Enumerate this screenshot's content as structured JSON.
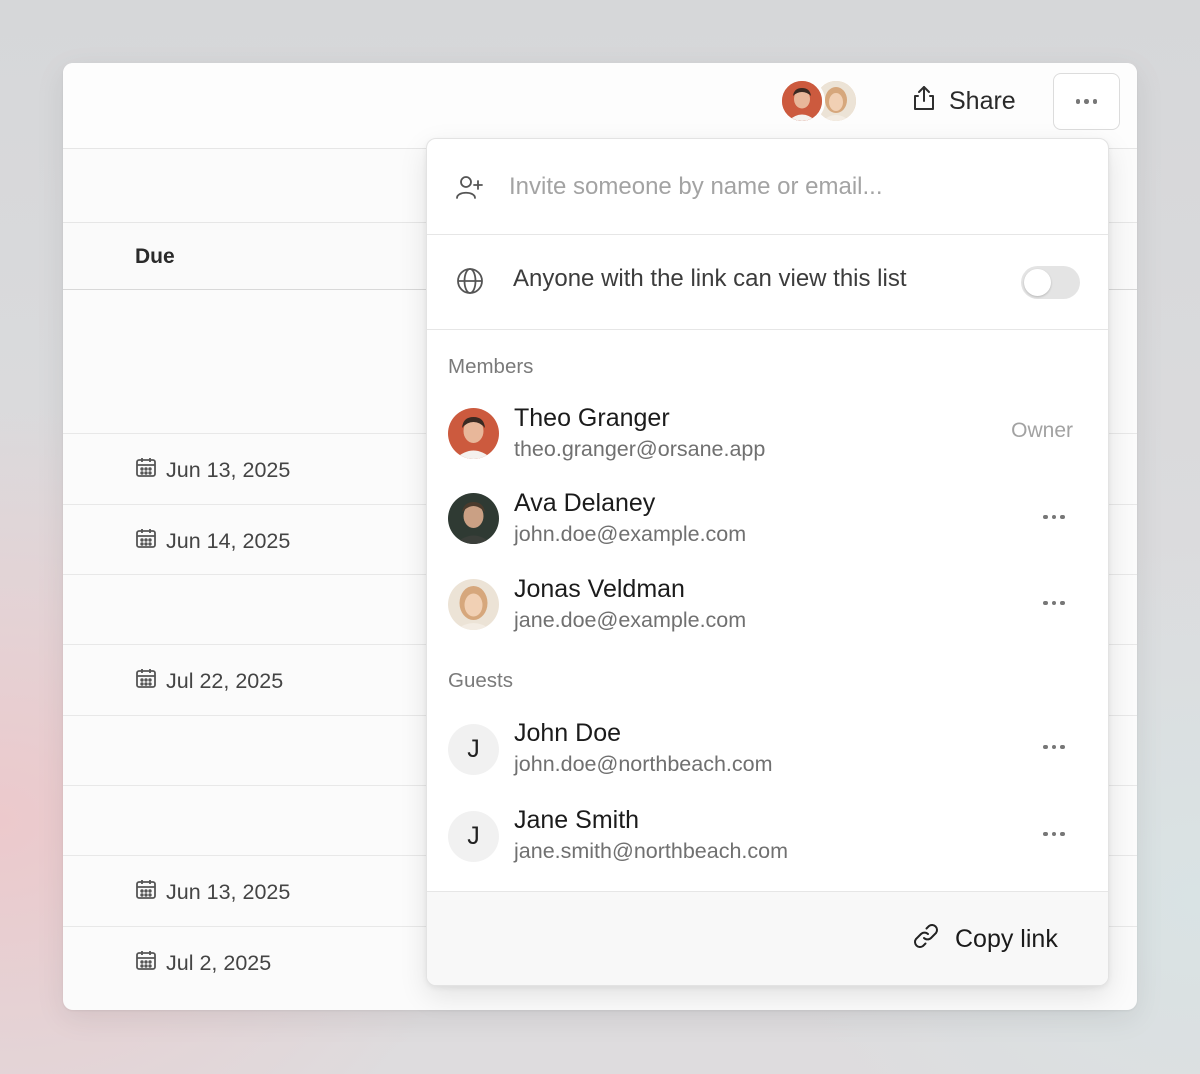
{
  "header": {
    "share_label": "Share",
    "avatars": [
      "Theo Granger",
      "Jonas Veldman"
    ]
  },
  "table": {
    "due_header": "Due",
    "rows": [
      {
        "due": ""
      },
      {
        "due": "Jun 13, 2025"
      },
      {
        "due": "Jun 14, 2025"
      },
      {
        "due": ""
      },
      {
        "due": "Jul 22, 2025"
      },
      {
        "due": ""
      },
      {
        "due": ""
      },
      {
        "due": "Jun 13, 2025"
      },
      {
        "due": "Jul 2, 2025"
      }
    ]
  },
  "share_popover": {
    "invite": {
      "placeholder": "Invite someone by name or email..."
    },
    "link_access": {
      "label": "Anyone with the link can view this list",
      "enabled": false
    },
    "members_label": "Members",
    "members": [
      {
        "name": "Theo Granger",
        "email": "theo.granger@orsane.app",
        "role": "Owner"
      },
      {
        "name": "Ava Delaney",
        "email": "john.doe@example.com"
      },
      {
        "name": "Jonas Veldman",
        "email": "jane.doe@example.com"
      }
    ],
    "guests_label": "Guests",
    "guests": [
      {
        "initial": "J",
        "name": "John Doe",
        "email": "john.doe@northbeach.com"
      },
      {
        "initial": "J",
        "name": "Jane Smith",
        "email": "jane.smith@northbeach.com"
      }
    ],
    "copy_link_label": "Copy link"
  },
  "colors": {
    "avatar_theo": "#c8583f",
    "avatar_ava": "#2f3a33",
    "avatar_jonas": "#d9b89a",
    "toggle_off": "#e4e4e4"
  },
  "icons": [
    "share-icon",
    "more-icon",
    "add-user-icon",
    "globe-icon",
    "calendar-icon",
    "link-icon"
  ]
}
